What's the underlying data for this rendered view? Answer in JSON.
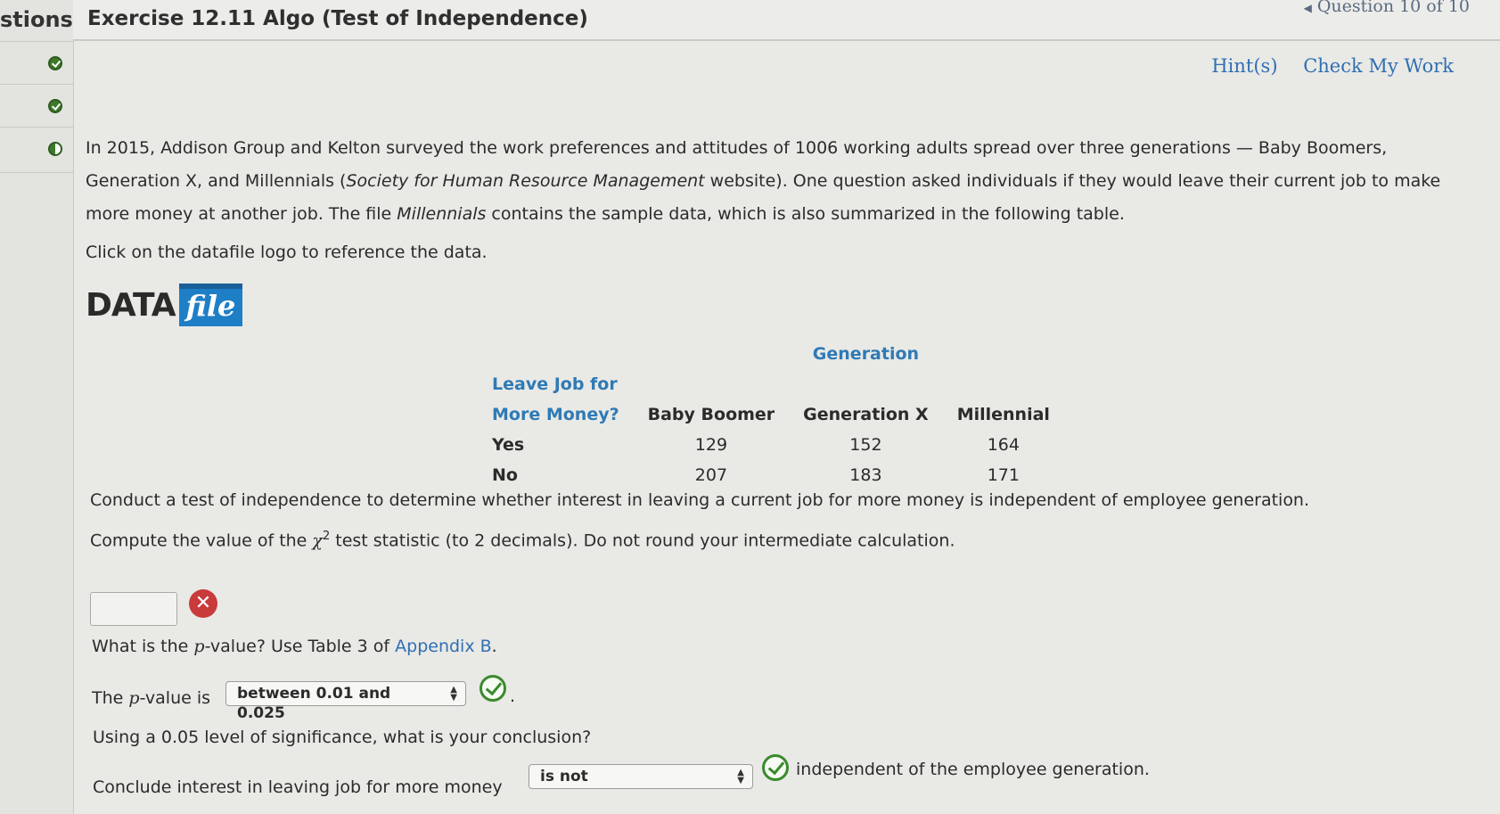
{
  "rail": {
    "title": "stions"
  },
  "header": {
    "title": "Exercise 12.11 Algo (Test of Independence)",
    "question_nav": "Question 10 of 10"
  },
  "links": {
    "hints": "Hint(s)",
    "check": "Check My Work"
  },
  "intro": {
    "p1_a": "In 2015, Addison Group and Kelton surveyed the work preferences and attitudes of 1006 working adults spread over three generations — Baby Boomers, Generation X, and Millennials (",
    "p1_italic": "Society for Human Resource Management",
    "p1_b": " website). One question asked individuals if they would leave their current job to make more money at another job. The file ",
    "p1_italic2": "Millennials",
    "p1_c": " contains the sample data, which is also summarized in the following table.",
    "p2": "Click on the datafile logo to reference the data."
  },
  "datafile": {
    "word": "DATA",
    "file": "file"
  },
  "table": {
    "group_header": "Generation",
    "row_header_1": "Leave Job for",
    "row_header_2": "More Money?",
    "columns": [
      "Baby Boomer",
      "Generation X",
      "Millennial"
    ],
    "rows": [
      {
        "label": "Yes",
        "values": [
          "129",
          "152",
          "164"
        ]
      },
      {
        "label": "No",
        "values": [
          "207",
          "183",
          "171"
        ]
      }
    ]
  },
  "questions": {
    "conduct": "Conduct a test of independence to determine whether interest in leaving a current job for more money is independent of employee generation.",
    "compute_a": "Compute the value of the ",
    "chi": "χ",
    "sup": "2",
    "compute_b": " test statistic (to 2 decimals). Do not round your intermediate calculation.",
    "chi_value": "",
    "pvalue_q_a": "What is the ",
    "p": "p",
    "pvalue_q_b": "-value? Use Table 3 of ",
    "appendix": "Appendix B",
    "period": ".",
    "pvalue_label_a": "The ",
    "pvalue_label_b": "-value is",
    "pvalue_selected": "between 0.01 and 0.025",
    "sig_q": "Using a 0.05 level of significance, what is your conclusion?",
    "conclude_label": "Conclude interest in leaving job for more money",
    "conclude_selected": "is not",
    "conclude_tail": "independent of the employee generation."
  }
}
